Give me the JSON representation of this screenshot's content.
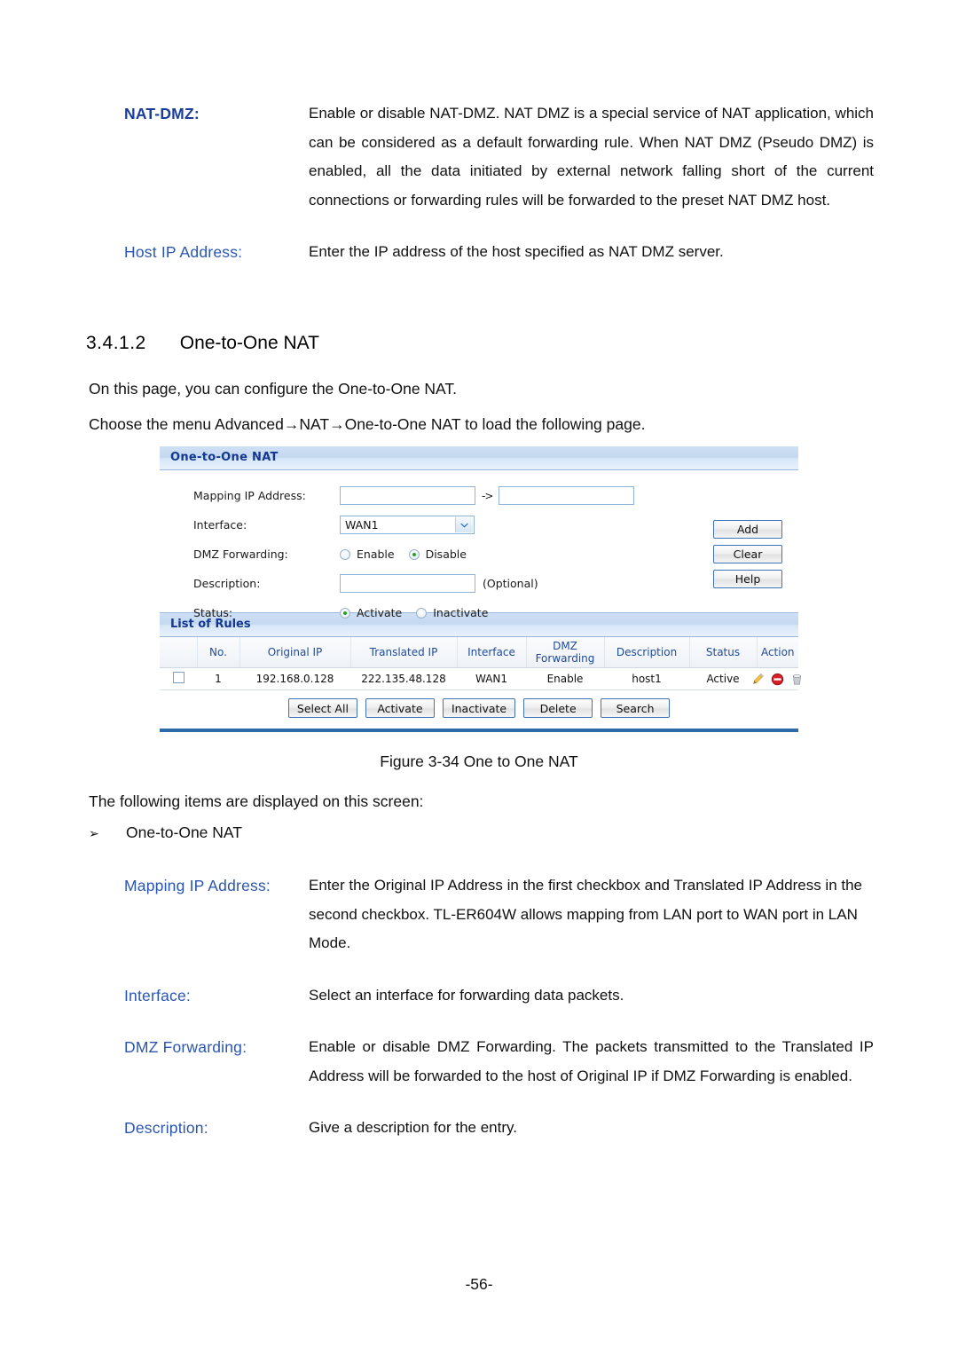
{
  "document": {
    "page_number": "-56-",
    "section": {
      "number": "3.4.1.2",
      "title": "One-to-One NAT"
    },
    "intro_paragraphs": [
      "On this page, you can configure the One-to-One NAT.",
      "Choose the menu Advanced→NAT→One-to-One NAT to load the following page."
    ],
    "figure_caption": "Figure 3-34 One to One NAT",
    "screen_items_intro": "The following items are displayed on this screen:",
    "bullet": {
      "marker": "➢",
      "label": "One-to-One NAT"
    },
    "definitions_top": [
      {
        "term": "NAT-DMZ:",
        "body": "Enable or disable NAT-DMZ. NAT DMZ is a special service of NAT application, which can be considered as a default forwarding rule. When NAT DMZ (Pseudo DMZ) is enabled, all the data initiated by external network falling short of the current connections or forwarding rules will be forwarded to the preset NAT DMZ host."
      },
      {
        "term": "Host IP Address:",
        "body": "Enter the IP address of the host specified as NAT DMZ server."
      }
    ],
    "definitions_bottom": [
      {
        "term": "Mapping IP Address:",
        "body": "Enter the Original IP Address in the first checkbox and Translated IP Address in the second checkbox. TL-ER604W allows mapping from LAN port to WAN port in LAN Mode."
      },
      {
        "term": "Interface:",
        "body": "Select an interface for forwarding data packets."
      },
      {
        "term": "DMZ Forwarding:",
        "body": "Enable or disable DMZ Forwarding. The packets transmitted to the Translated IP Address will be forwarded to the host of Original IP if DMZ Forwarding is enabled."
      },
      {
        "term": "Description:",
        "body": "Give a description for the entry."
      }
    ]
  },
  "figure": {
    "panel_title": "One-to-One NAT",
    "form": {
      "mapping_ip_label": "Mapping IP Address:",
      "mapping_ip_original_value": "",
      "mapping_ip_original_placeholder": "",
      "mapping_arrow": "->",
      "mapping_ip_translated_value": "",
      "mapping_ip_translated_placeholder": "",
      "interface_label": "Interface:",
      "interface_value": "WAN1",
      "interface_options": [
        "WAN1"
      ],
      "dmz_forwarding_label": "DMZ Forwarding:",
      "dmz_enable_label": "Enable",
      "dmz_disable_label": "Disable",
      "dmz_selected": "Disable",
      "description_label": "Description:",
      "description_value": "",
      "description_optional_note": "(Optional)",
      "status_label": "Status:",
      "status_activate_label": "Activate",
      "status_inactivate_label": "Inactivate",
      "status_selected": "Activate"
    },
    "side_buttons": [
      {
        "label": "Add"
      },
      {
        "label": "Clear"
      },
      {
        "label": "Help"
      }
    ],
    "list": {
      "title": "List of Rules",
      "columns": [
        "",
        "No.",
        "Original IP",
        "Translated IP",
        "Interface",
        "DMZ Forwarding",
        "Description",
        "Status",
        "Action"
      ],
      "rows": [
        {
          "checked": false,
          "no": "1",
          "original_ip": "192.168.0.128",
          "translated_ip": "222.135.48.128",
          "interface": "WAN1",
          "dmz_forwarding": "Enable",
          "description": "host1",
          "status": "Active",
          "actions": [
            "edit-pencil-icon",
            "disable-icon",
            "delete-trash-icon"
          ]
        }
      ]
    },
    "bottom_buttons": [
      {
        "label": "Select All"
      },
      {
        "label": "Activate"
      },
      {
        "label": "Inactivate"
      },
      {
        "label": "Delete"
      },
      {
        "label": "Search"
      }
    ],
    "colors": {
      "panel_header_text": "#13378f",
      "panel_header_bg": "#c8dcf2",
      "table_header_text": "#1f4b9b",
      "button_border": "#3f73b5",
      "rule_line": "#2e6aa8",
      "radio_dot": "#22a422",
      "term_blue": "#2b56b0"
    }
  }
}
